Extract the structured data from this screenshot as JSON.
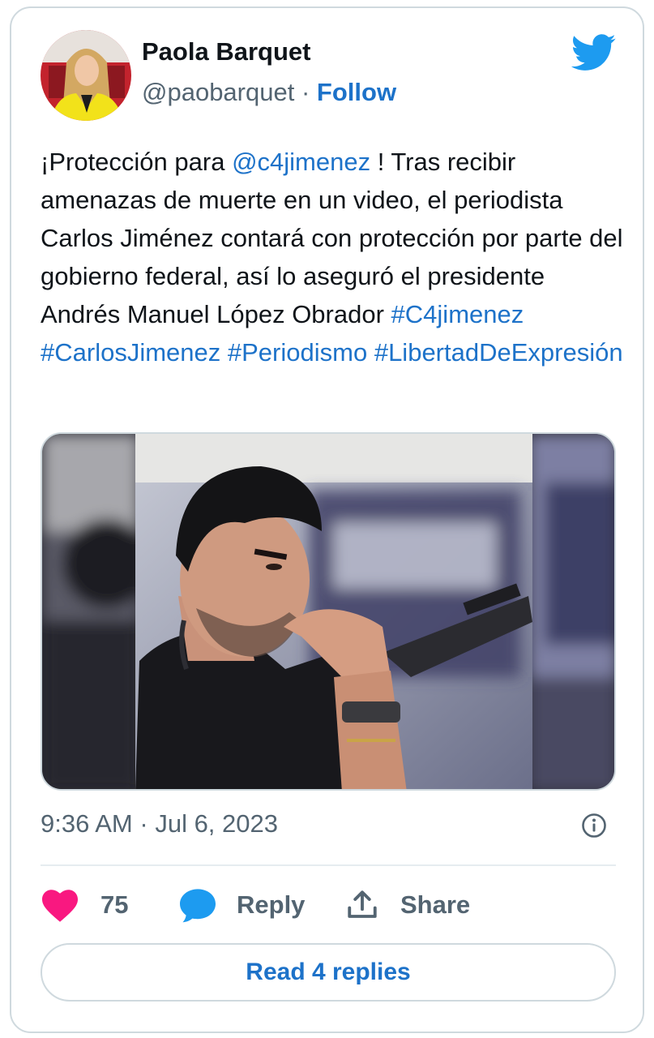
{
  "author": {
    "name": "Paola Barquet",
    "handle": "@paobarquet",
    "separator": "·",
    "follow_label": "Follow",
    "avatar_icon": "profile-photo-avatar"
  },
  "brand": {
    "icon": "twitter-bird-icon",
    "color": "#1d9bf0"
  },
  "tweet": {
    "text_part1": "¡Protección para ",
    "mention": "@c4jimenez",
    "text_part2": " ! Tras recibir amenazas de muerte en un video, el periodista Carlos Jiménez contará con protección por parte del gobierno federal, así lo aseguró el presidente Andrés Manuel López Obrador ",
    "hashtags": [
      "#C4jimenez",
      "#CarlosJimenez",
      "#Periodismo",
      "#LibertadDeExpresión"
    ]
  },
  "media": {
    "kind": "photo",
    "icon": "photo-man-with-rifle"
  },
  "meta": {
    "time": "9:36 AM",
    "separator": "·",
    "date": "Jul 6, 2023",
    "info_icon": "info-icon"
  },
  "actions": {
    "like_count": "75",
    "reply_label": "Reply",
    "share_label": "Share"
  },
  "footer": {
    "read_replies_label": "Read 4 replies"
  },
  "colors": {
    "link": "#1d72c9",
    "secondary_text": "#536471",
    "like_heart": "#f91880",
    "reply_bubble": "#1d9bf0",
    "border": "#cfd9de"
  }
}
